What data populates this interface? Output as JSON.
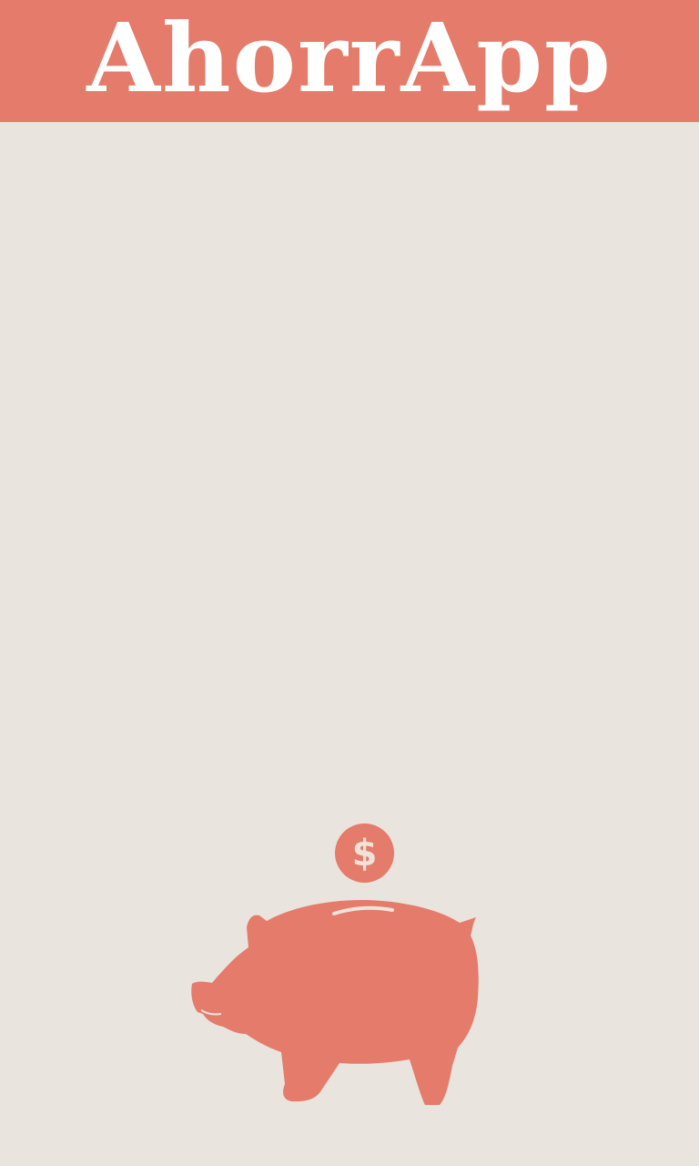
{
  "header": {
    "title": "AhorrApp"
  },
  "illustration": {
    "coin_symbol": "$",
    "coin_icon": "dollar-coin-icon",
    "piggy_icon": "piggy-bank-icon"
  },
  "colors": {
    "accent": "#e57b6a",
    "background": "#e9e4dd",
    "title_text": "#ffffff",
    "coin_symbol": "#efe3d9"
  }
}
